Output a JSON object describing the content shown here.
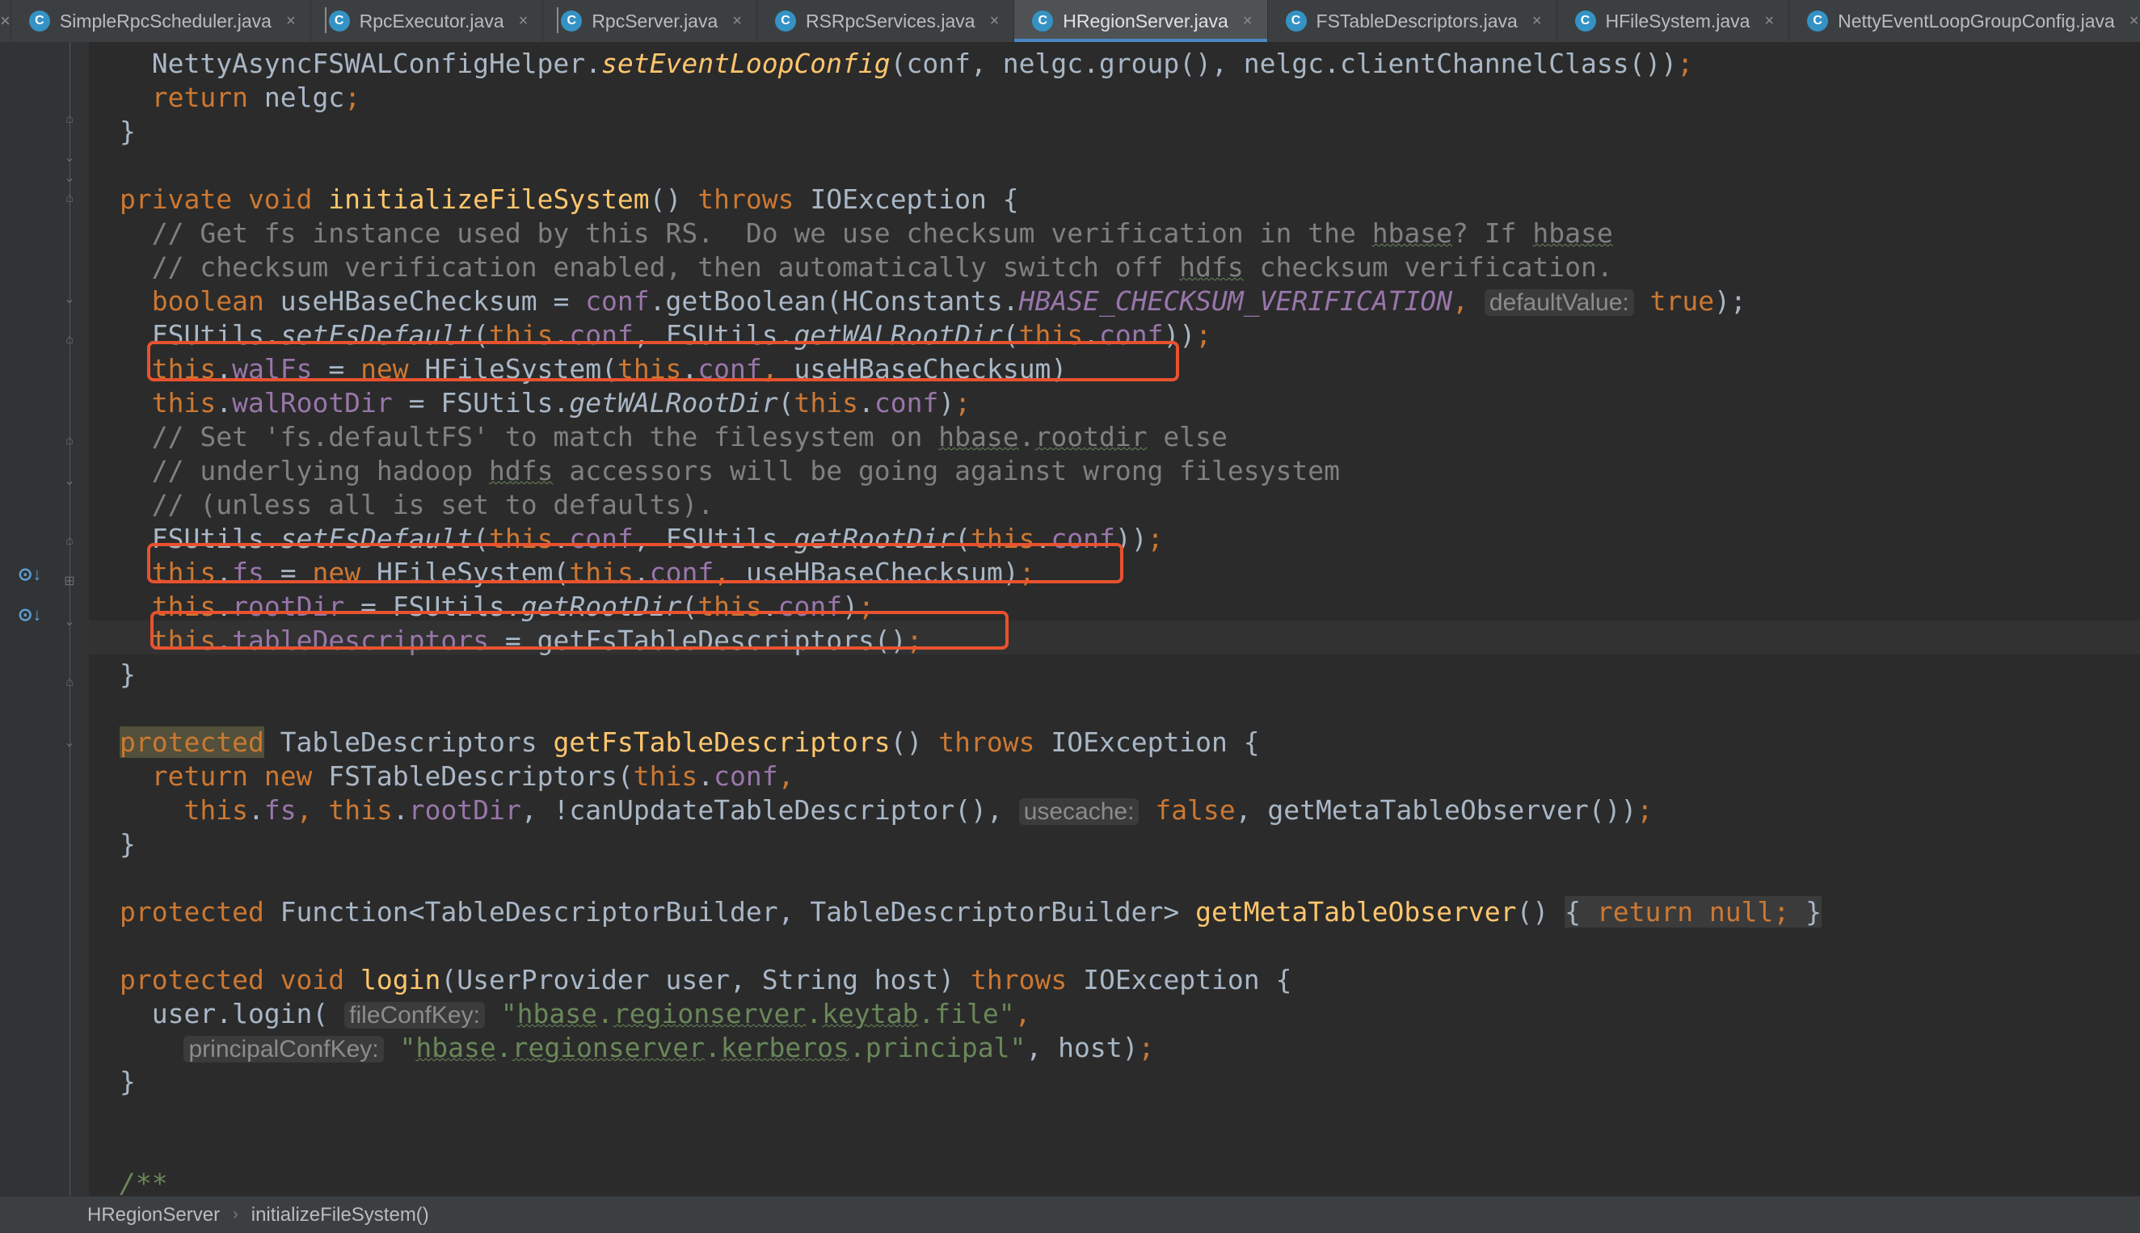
{
  "tabs": [
    {
      "label": "SimpleRpcScheduler.java",
      "active": false
    },
    {
      "label": "RpcExecutor.java",
      "active": false
    },
    {
      "label": "RpcServer.java",
      "active": false
    },
    {
      "label": "RSRpcServices.java",
      "active": false
    },
    {
      "label": "HRegionServer.java",
      "active": true
    },
    {
      "label": "FSTableDescriptors.java",
      "active": false
    },
    {
      "label": "HFileSystem.java",
      "active": false
    },
    {
      "label": "NettyEventLoopGroupConfig.java",
      "active": false
    }
  ],
  "tab_icon_letter": "C",
  "close_glyph": "×",
  "overflow_glyph": "⌄",
  "code": {
    "l01": {
      "a": "  NettyAsyncFSWALConfigHelper.",
      "b": "setEventLoopConfig",
      "c": "(conf, nelgc.group(), nelgc.clientChannelClass())",
      "d": ";"
    },
    "l02": {
      "a": "  ",
      "b": "return",
      "c": " nelgc",
      "d": ";"
    },
    "l03": {
      "a": "}"
    },
    "l05": {
      "a": "private void",
      "b": " ",
      "c": "initializeFileSystem",
      "d": "() ",
      "e": "throws",
      "f": " IOException {"
    },
    "l06": {
      "a": "  // Get fs instance used by this RS.  Do we use checksum verification in the ",
      "b": "hbase",
      "c": "? If ",
      "d": "hbase"
    },
    "l07": {
      "a": "  // checksum verification enabled, then automatically switch off ",
      "b": "hdfs",
      "c": " checksum verification."
    },
    "l08": {
      "a": "  ",
      "b": "boolean",
      "c": " useHBaseChecksum = ",
      "d": "conf",
      "e": ".getBoolean(HConstants.",
      "f": "HBASE_CHECKSUM_VERIFICATION",
      "g": ",",
      "h": "defaultValue:",
      "i": " true",
      "j": ");"
    },
    "l09": {
      "a": "  FSUtils.",
      "b": "setFsDefault",
      "c": "(",
      "d": "this",
      "e": ".",
      "f": "conf",
      "g": ", FSUtils.",
      "h": "getWALRootDir",
      "i": "(",
      "j": "this",
      "k": ".",
      "l": "conf",
      "m": "))",
      "n": ";"
    },
    "l10": {
      "a": "  ",
      "b": "this",
      "c": ".",
      "d": "walFs",
      "e": " = ",
      "f": "new",
      "g": " HFileSystem(",
      "h": "this",
      "i": ".",
      "j": "conf",
      "k": ", ",
      "l": "useHBaseChecksum)"
    },
    "l11": {
      "a": "  ",
      "b": "this",
      "c": ".",
      "d": "walRootDir",
      "e": " = FSUtils.",
      "f": "getWALRootDir",
      "g": "(",
      "h": "this",
      "i": ".",
      "j": "conf",
      "k": ")",
      "l": ";"
    },
    "l12": {
      "a": "  // Set 'fs.defaultFS' to match the filesystem on ",
      "b": "hbase",
      "c": ".",
      "d": "rootdir",
      "e": " else"
    },
    "l13": {
      "a": "  // underlying hadoop ",
      "b": "hdfs",
      "c": " accessors will be going against wrong filesystem"
    },
    "l14": {
      "a": "  // (unless all is set to defaults)."
    },
    "l15": {
      "a": "  FSUtils.",
      "b": "setFsDefault",
      "c": "(",
      "d": "this",
      "e": ".",
      "f": "conf",
      "g": ", FSUtils.",
      "h": "getRootDir",
      "i": "(",
      "j": "this",
      "k": ".",
      "l": "conf",
      "m": "))",
      "n": ";"
    },
    "l16": {
      "a": "  ",
      "b": "this",
      "c": ".",
      "d": "fs",
      "e": " = ",
      "f": "new",
      "g": " HFileSystem(",
      "h": "this",
      "i": ".",
      "j": "conf",
      "k": ", ",
      "l": "useHBaseChecksum)",
      "m": ";"
    },
    "l17": {
      "a": "  ",
      "b": "this",
      "c": ".",
      "d": "rootDir",
      "e": " = FSUtils.",
      "f": "getRootDir",
      "g": "(",
      "h": "this",
      "i": ".",
      "j": "conf",
      "k": ")",
      "l": ";"
    },
    "l18": {
      "a": "  ",
      "b": "this",
      "c": ".",
      "d": "tableDescriptors",
      "e": " = getFsTableDescriptors()",
      "f": ";"
    },
    "l19": {
      "a": "}"
    },
    "l21": {
      "a": "protected",
      "b": " TableDescriptors ",
      "c": "getFsTableDescriptors",
      "d": "() ",
      "e": "throws",
      "f": " IOException {"
    },
    "l22": {
      "a": "  ",
      "b": "return new",
      "c": " FSTableDescriptors(",
      "d": "this",
      "e": ".",
      "f": "conf",
      "g": ","
    },
    "l23": {
      "a": "    ",
      "b": "this",
      "c": ".",
      "d": "fs",
      "e": ", ",
      "f": "this",
      "g": ".",
      "h": "rootDir",
      "i": ", !canUpdateTableDescriptor(), ",
      "j": "usecache:",
      "k": " false",
      "l": ", getMetaTableObserver())",
      "m": ";"
    },
    "l24": {
      "a": "}"
    },
    "l26": {
      "a": "protected",
      "b": " Function<TableDescriptorBuilder, TableDescriptorBuilder> ",
      "c": "getMetaTableObserver",
      "d": "() ",
      "e": "{",
      "f": " return null",
      "g": ";",
      "h": " }"
    },
    "l28": {
      "a": "protected void",
      "b": " ",
      "c": "login",
      "d": "(UserProvider user, String host) ",
      "e": "throws",
      "f": " IOException {"
    },
    "l29": {
      "a": "  user.login( ",
      "b": "fileConfKey:",
      "c": " \"",
      "d": "hbase",
      "e": ".",
      "f": "regionserver",
      "g": ".",
      "h": "keytab",
      "i": ".file\"",
      "j": ","
    },
    "l30": {
      "a": "    ",
      "b": "principalConfKey:",
      "c": " \"",
      "d": "hbase",
      "e": ".",
      "f": "regionserver",
      "g": ".",
      "h": "kerberos",
      "i": ".principal\"",
      "j": ", host)",
      "k": ";"
    },
    "l31": {
      "a": "}"
    },
    "l34": {
      "a": "/**"
    }
  },
  "gutter_icon_glyph": "⊙↓",
  "breadcrumb": {
    "class_name": "HRegionServer",
    "separator": "›",
    "method_name": "initializeFileSystem()"
  },
  "colors": {
    "background": "#2b2b2b",
    "keyword": "#cc7832",
    "method": "#ffc66d",
    "field": "#9876aa",
    "comment": "#808080",
    "string": "#6a8759",
    "annotation_box": "#e8522f"
  }
}
